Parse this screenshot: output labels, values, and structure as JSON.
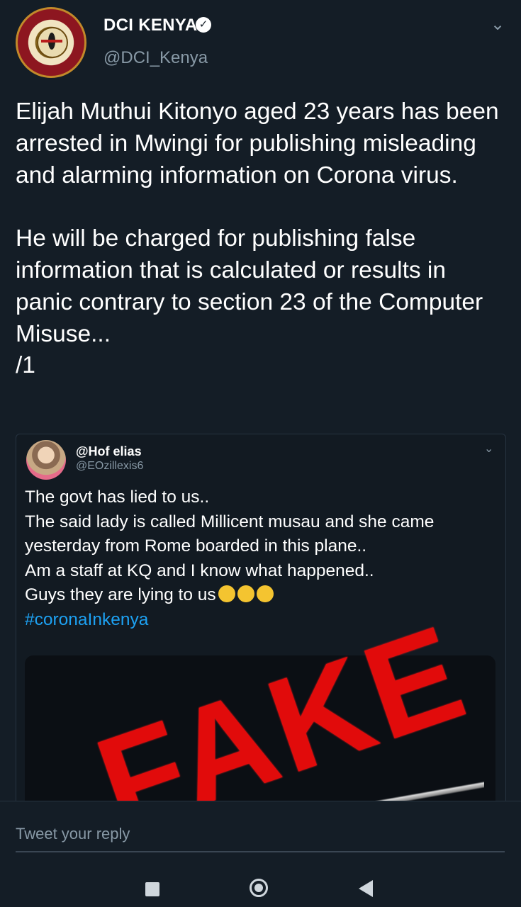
{
  "tweet": {
    "display_name": "DCI KENYA",
    "verified_icon": "verified-badge-icon",
    "handle": "@DCI_Kenya",
    "text": "Elijah Muthui Kitonyo aged 23 years has been arrested in Mwingi for publishing misleading and alarming information on Corona virus.\n\nHe will be charged for publishing false information that is calculated or results in panic contrary to section 23 of the Computer Misuse...\n/1"
  },
  "quoted_tweet": {
    "display_name": "@Hof elias",
    "handle": "@EOzillexis6",
    "lines": [
      "The govt has lied to us..",
      "The said lady is called Millicent musau and she came",
      "yesterday from Rome boarded in this plane..",
      "Am a staff at KQ and I know what happened..",
      "Guys they are lying to us"
    ],
    "emojis": [
      "crying-face-emoji",
      "unamused-face-emoji",
      "unamused-face-emoji"
    ],
    "hashtag": "#coronaInkenya",
    "stamp_text": "FAKE"
  },
  "reply": {
    "placeholder": "Tweet your reply"
  },
  "colors": {
    "background": "#141d26",
    "secondary_text": "#8899a6",
    "link": "#1da1f2",
    "stamp": "#e10b0b"
  }
}
